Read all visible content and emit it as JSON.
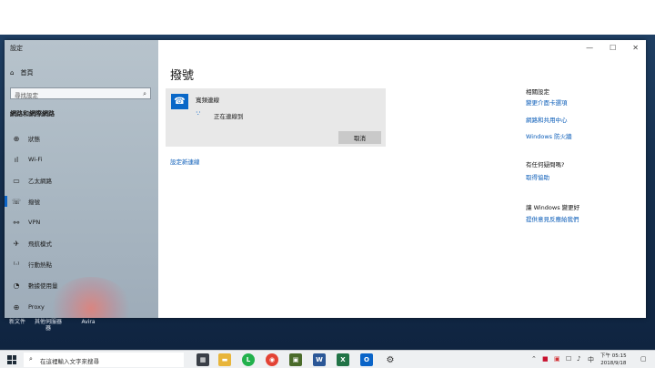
{
  "window": {
    "title": "設定"
  },
  "sidebar": {
    "home": "首頁",
    "search_placeholder": "尋找設定",
    "section": "網路和網際網路",
    "items": [
      {
        "label": "狀態",
        "icon": "globe-icon"
      },
      {
        "label": "Wi-Fi",
        "icon": "wifi-icon"
      },
      {
        "label": "乙太網路",
        "icon": "ethernet-icon"
      },
      {
        "label": "撥號",
        "icon": "dialup-icon"
      },
      {
        "label": "VPN",
        "icon": "vpn-icon"
      },
      {
        "label": "飛航模式",
        "icon": "airplane-icon"
      },
      {
        "label": "行動熱點",
        "icon": "hotspot-icon"
      },
      {
        "label": "數據使用量",
        "icon": "data-usage-icon"
      },
      {
        "label": "Proxy",
        "icon": "proxy-icon"
      }
    ]
  },
  "main": {
    "title": "撥號",
    "connection": {
      "name": "寬頻連線",
      "status": "正在連線到",
      "cancel": "取消"
    },
    "add_connection": "設定新連線"
  },
  "related": {
    "heading": "相關設定",
    "links": [
      "變更介面卡選項",
      "網路和共用中心",
      "Windows 防火牆"
    ],
    "question_heading": "有任何疑問嗎?",
    "help_link": "取得協助",
    "feedback_heading": "讓 Windows 變更好",
    "feedback_link": "提供意見反應給我們"
  },
  "desktop_icons": [
    "新文件",
    "其他伺服器\n器",
    "Avira"
  ],
  "taskbar": {
    "search_placeholder": "在這裡輸入文字來搜尋",
    "time": "下午 05:15",
    "date": "2018/9/18"
  },
  "colors": {
    "accent": "#0a64c8",
    "link": "#0a5cb8"
  }
}
